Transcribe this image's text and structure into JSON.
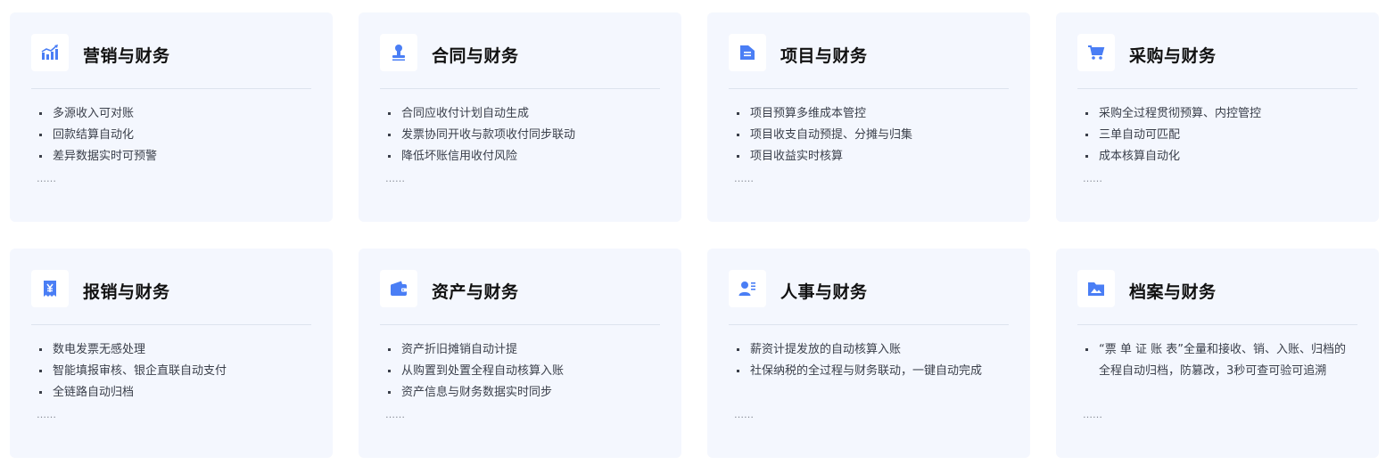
{
  "accent_color": "#4a7ef5",
  "cards": [
    {
      "icon": "chart-icon",
      "title": "营销与财务",
      "items": [
        "多源收入可对账",
        "回款结算自动化",
        "差异数据实时可预警"
      ],
      "more": "……"
    },
    {
      "icon": "stamp-icon",
      "title": "合同与财务",
      "items": [
        "合同应收付计划自动生成",
        "发票协同开收与款项收付同步联动",
        "降低坏账信用收付风险"
      ],
      "more": "……"
    },
    {
      "icon": "folder-doc-icon",
      "title": "项目与财务",
      "items": [
        "项目预算多维成本管控",
        "项目收支自动预提、分摊与归集",
        "项目收益实时核算"
      ],
      "more": "……"
    },
    {
      "icon": "cart-icon",
      "title": "采购与财务",
      "items": [
        "采购全过程贯彻预算、内控管控",
        "三单自动可匹配",
        "成本核算自动化"
      ],
      "more": "……"
    },
    {
      "icon": "receipt-icon",
      "title": "报销与财务",
      "items": [
        "数电发票无感处理",
        "智能填报审核、银企直联自动支付",
        "全链路自动归档"
      ],
      "more": "……"
    },
    {
      "icon": "wallet-icon",
      "title": "资产与财务",
      "items": [
        "资产折旧摊销自动计提",
        "从购置到处置全程自动核算入账",
        "资产信息与财务数据实时同步"
      ],
      "more": "……"
    },
    {
      "icon": "user-card-icon",
      "title": "人事与财务",
      "items": [
        "薪资计提发放的自动核算入账",
        "社保纳税的全过程与财务联动，一键自动完成"
      ],
      "more": "……"
    },
    {
      "icon": "folder-icon",
      "title": "档案与财务",
      "items": [
        "“票 单 证 账 表”全量和接收、销、入账、归档的全程自动归档，防篡改，3秒可查可验可追溯"
      ],
      "more": "……"
    }
  ]
}
